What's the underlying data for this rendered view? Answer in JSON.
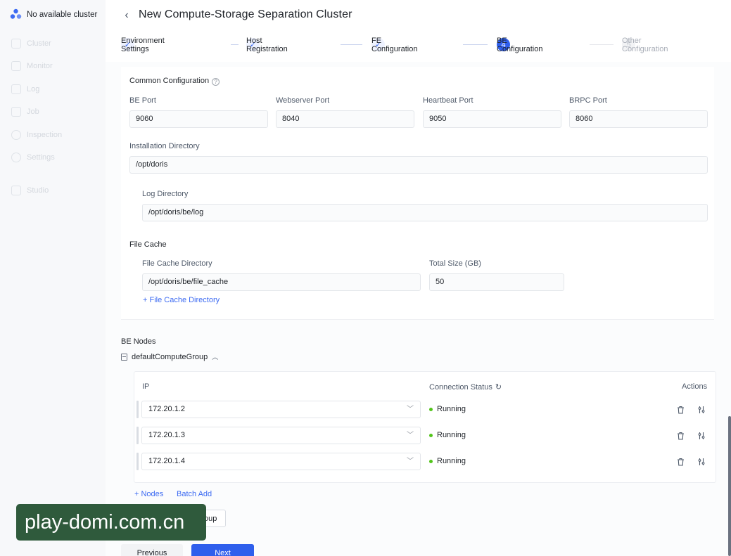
{
  "sidebar": {
    "brand": "No available cluster",
    "items": [
      {
        "label": "Cluster",
        "icon": "cluster-icon"
      },
      {
        "label": "Monitor",
        "icon": "monitor-icon"
      },
      {
        "label": "Log",
        "icon": "log-icon"
      },
      {
        "label": "Job",
        "icon": "job-icon"
      },
      {
        "label": "Inspection",
        "icon": "inspection-icon"
      },
      {
        "label": "Settings",
        "icon": "settings-icon"
      },
      {
        "label": "Studio",
        "icon": "studio-icon"
      }
    ]
  },
  "header": {
    "title": "New Compute-Storage Separation Cluster"
  },
  "steps": [
    {
      "label": "Environment Settings",
      "state": "done"
    },
    {
      "label": "Host Registration",
      "state": "done"
    },
    {
      "label": "FE Configuration",
      "state": "done"
    },
    {
      "number": "4",
      "label": "BE Configuration",
      "state": "active"
    },
    {
      "number": "5",
      "label": "Other Configuration",
      "state": "pending"
    }
  ],
  "common": {
    "title": "Common Configuration",
    "help": "?",
    "be_port": {
      "label": "BE Port",
      "value": "9060"
    },
    "webserver_port": {
      "label": "Webserver Port",
      "value": "8040"
    },
    "heartbeat_port": {
      "label": "Heartbeat Port",
      "value": "9050"
    },
    "brpc_port": {
      "label": "BRPC Port",
      "value": "8060"
    },
    "install_dir": {
      "label": "Installation Directory",
      "value": "/opt/doris"
    },
    "log_dir": {
      "label": "Log Directory",
      "value": "/opt/doris/be/log"
    },
    "file_cache": {
      "title": "File Cache",
      "dir_label": "File Cache Directory",
      "dir_value": "/opt/doris/be/file_cache",
      "size_label": "Total Size (GB)",
      "size_value": "50",
      "add_link": "+ File Cache Directory"
    }
  },
  "be_nodes": {
    "title": "BE Nodes",
    "group_name": "defaultComputeGroup",
    "columns": {
      "ip": "IP",
      "status": "Connection Status",
      "actions": "Actions"
    },
    "rows": [
      {
        "ip": "172.20.1.2",
        "status": "Running"
      },
      {
        "ip": "172.20.1.3",
        "status": "Running"
      },
      {
        "ip": "172.20.1.4",
        "status": "Running"
      }
    ],
    "add_nodes": "+ Nodes",
    "batch_add": "Batch Add",
    "create_group": "+ Create Compute Group"
  },
  "footer": {
    "previous": "Previous",
    "next": "Next"
  },
  "watermark": "play-domi.com.cn",
  "colors": {
    "accent": "#2f5fec",
    "running": "#52c41a"
  }
}
